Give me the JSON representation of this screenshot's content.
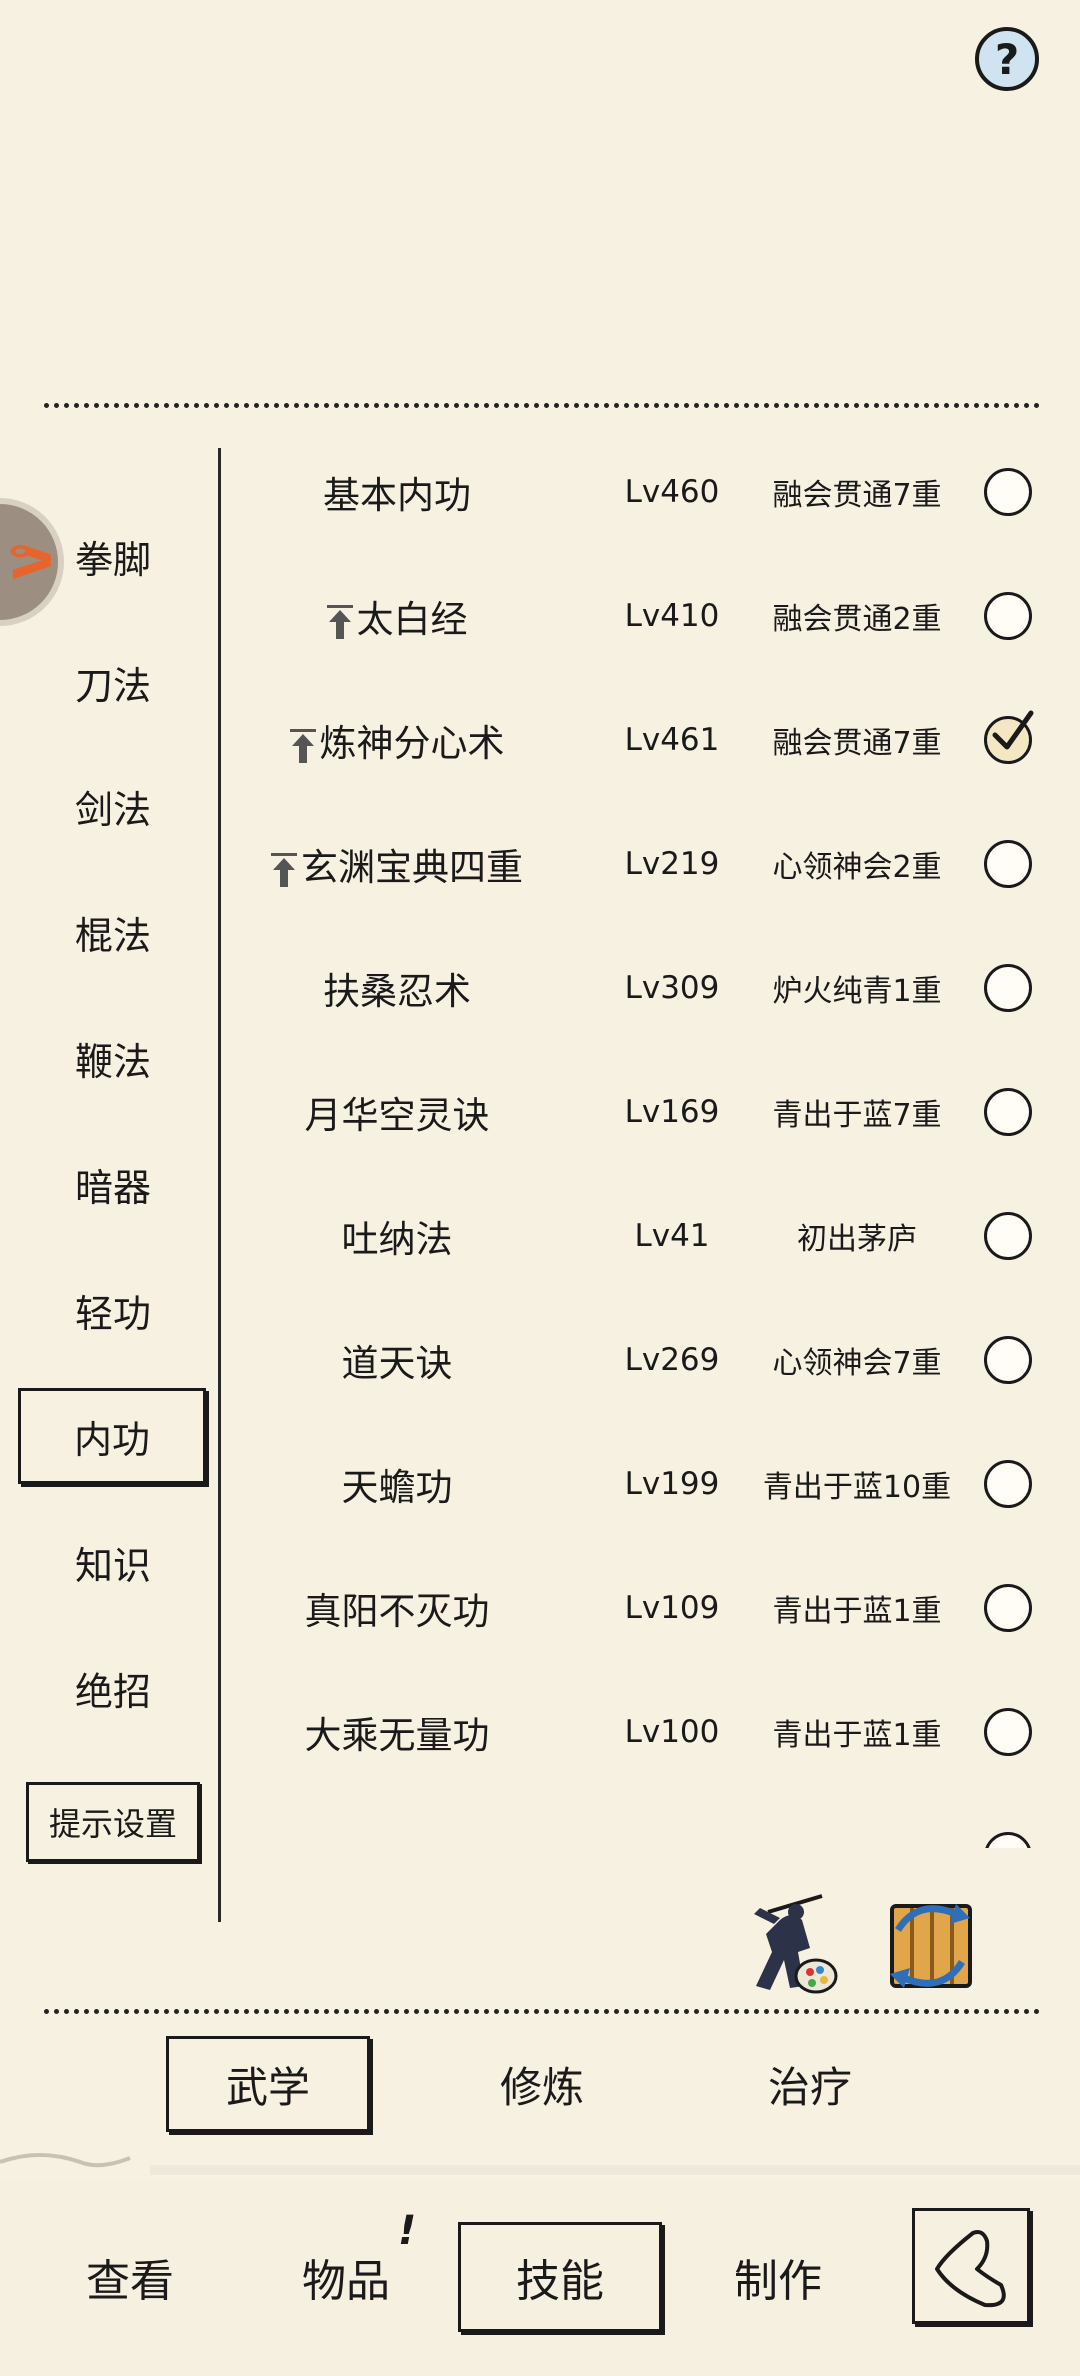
{
  "help": {
    "label": "?"
  },
  "categories": [
    {
      "label": "拳脚"
    },
    {
      "label": "刀法"
    },
    {
      "label": "剑法"
    },
    {
      "label": "棍法"
    },
    {
      "label": "鞭法"
    },
    {
      "label": "暗器"
    },
    {
      "label": "轻功"
    },
    {
      "label": "内功"
    },
    {
      "label": "知识"
    },
    {
      "label": "绝招"
    }
  ],
  "active_category": "内功",
  "hint_button": "提示设置",
  "skills": [
    {
      "name": "基本内功",
      "level": "Lv460",
      "rank": "融会贯通7重",
      "upgradable": false,
      "selected": false
    },
    {
      "name": "太白经",
      "level": "Lv410",
      "rank": "融会贯通2重",
      "upgradable": true,
      "selected": false
    },
    {
      "name": "炼神分心术",
      "level": "Lv461",
      "rank": "融会贯通7重",
      "upgradable": true,
      "selected": true
    },
    {
      "name": "玄渊宝典四重",
      "level": "Lv219",
      "rank": "心领神会2重",
      "upgradable": true,
      "selected": false
    },
    {
      "name": "扶桑忍术",
      "level": "Lv309",
      "rank": "炉火纯青1重",
      "upgradable": false,
      "selected": false
    },
    {
      "name": "月华空灵诀",
      "level": "Lv169",
      "rank": "青出于蓝7重",
      "upgradable": false,
      "selected": false
    },
    {
      "name": "吐纳法",
      "level": "Lv41",
      "rank": "初出茅庐",
      "upgradable": false,
      "selected": false
    },
    {
      "name": "道天诀",
      "level": "Lv269",
      "rank": "心领神会7重",
      "upgradable": false,
      "selected": false
    },
    {
      "name": "天蟾功",
      "level": "Lv199",
      "rank": "青出于蓝10重",
      "upgradable": false,
      "selected": false
    },
    {
      "name": "真阳不灭功",
      "level": "Lv109",
      "rank": "青出于蓝1重",
      "upgradable": false,
      "selected": false
    },
    {
      "name": "大乘无量功",
      "level": "Lv100",
      "rank": "青出于蓝1重",
      "upgradable": false,
      "selected": false
    }
  ],
  "sub_tabs": [
    {
      "label": "武学",
      "active": true
    },
    {
      "label": "修炼",
      "active": false
    },
    {
      "label": "治疗",
      "active": false
    }
  ],
  "nav_tabs": [
    {
      "label": "查看",
      "active": false
    },
    {
      "label": "物品",
      "active": false,
      "badge": "!"
    },
    {
      "label": "技能",
      "active": true
    },
    {
      "label": "制作",
      "active": false
    }
  ],
  "icons": {
    "help": "question-icon",
    "avatar": "character-avatar-icon",
    "upgrade": "up-arrow-icon",
    "check": "checkmark-icon",
    "player": "swordsman-palette-icon",
    "swap": "swap-scroll-icon",
    "back": "back-arrow-icon"
  },
  "colors": {
    "background": "#f7f1e2",
    "ink": "#1a1a1a",
    "help_fill": "#cfe3f0",
    "avatar_accent": "#e7652c"
  }
}
